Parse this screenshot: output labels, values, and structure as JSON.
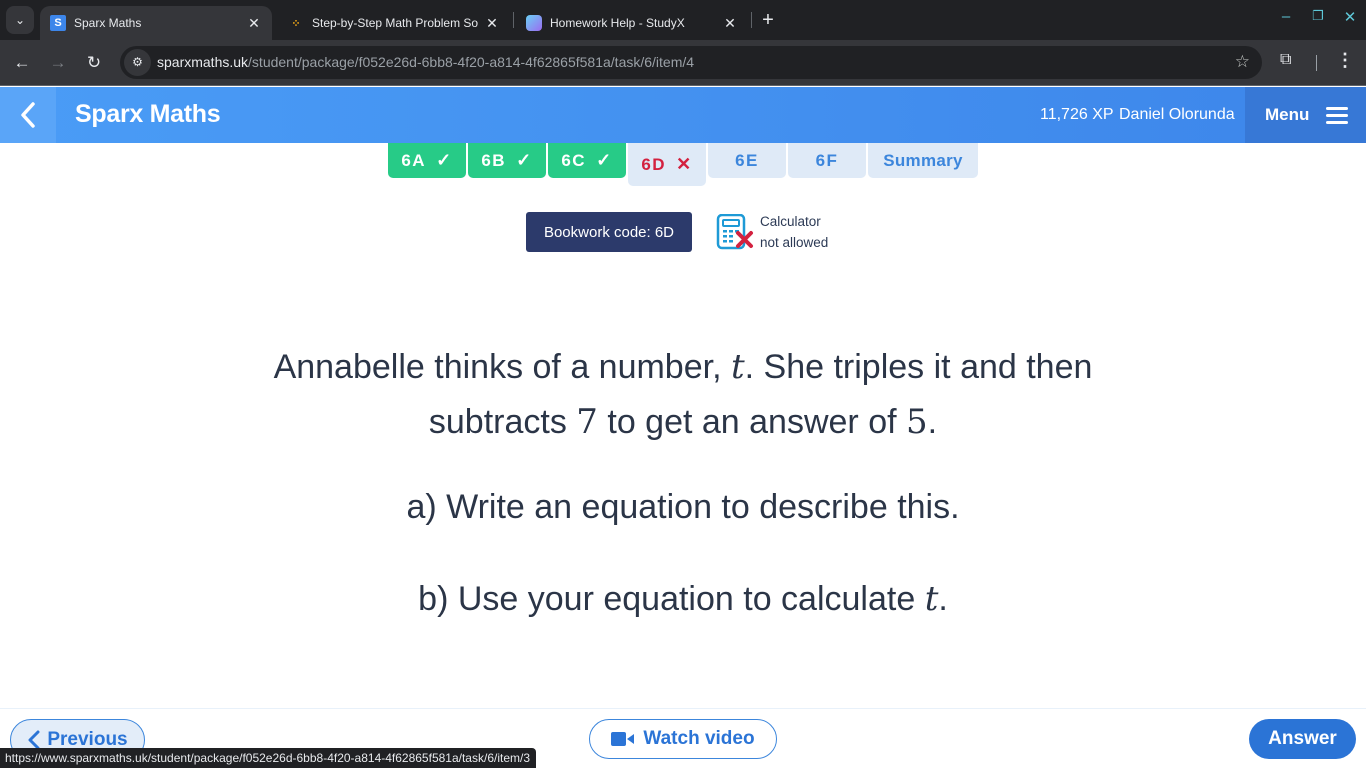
{
  "browser": {
    "tabs": [
      {
        "title": "Sparx Maths",
        "favicon": "S",
        "favicon_color": "#3d86ea",
        "active": true
      },
      {
        "title": "Step-by-Step Math Problem Sol",
        "favicon": "step-icon",
        "favicon_color": "#e8a317",
        "active": false
      },
      {
        "title": "Homework Help - StudyX",
        "favicon": "studyx-icon",
        "favicon_color": "#8b6cf0",
        "active": false
      }
    ],
    "tab_close": "✕",
    "new_tab": "+",
    "url_host": "sparxmaths.uk",
    "url_path": "/student/package/f052e26d-6bb8-4f20-a814-4f62865f581a/task/6/item/4",
    "status_url": "https://www.sparxmaths.uk/student/package/f052e26d-6bb8-4f20-a814-4f62865f581a/task/6/item/3"
  },
  "header": {
    "brand": "Sparx Maths",
    "xp": "11,726 XP",
    "user": "Daniel Olorunda",
    "menu_label": "Menu"
  },
  "task_tabs": [
    {
      "label": "6A",
      "status": "done",
      "mark": "✓"
    },
    {
      "label": "6B",
      "status": "done",
      "mark": "✓"
    },
    {
      "label": "6C",
      "status": "done",
      "mark": "✓"
    },
    {
      "label": "6D",
      "status": "wrong",
      "mark": "✕"
    },
    {
      "label": "6E",
      "status": "todo",
      "mark": ""
    },
    {
      "label": "6F",
      "status": "todo",
      "mark": ""
    },
    {
      "label": "Summary",
      "status": "todo",
      "mark": ""
    }
  ],
  "bookwork": {
    "label": "Bookwork code: 6D"
  },
  "calculator": {
    "line1": "Calculator",
    "line2": "not allowed"
  },
  "question": {
    "l1_a": "Annabelle thinks of a number, ",
    "l1_var": "t",
    "l1_b": ". She triples it and then",
    "l2_a": "subtracts ",
    "l2_num1": "7",
    "l2_b": " to get an answer of ",
    "l2_num2": "5",
    "l2_c": ".",
    "part_a": "a) Write an equation to describe this.",
    "part_b_text": "b) Use your equation to calculate ",
    "part_b_var": "t",
    "part_b_end": "."
  },
  "footer": {
    "previous": "Previous",
    "watch_video": "Watch video",
    "answer": "Answer"
  },
  "colors": {
    "brand_blue": "#3d86ea",
    "done_green": "#27cb87",
    "wrong_red": "#d3213f",
    "bookwork_navy": "#2c3a6b"
  }
}
